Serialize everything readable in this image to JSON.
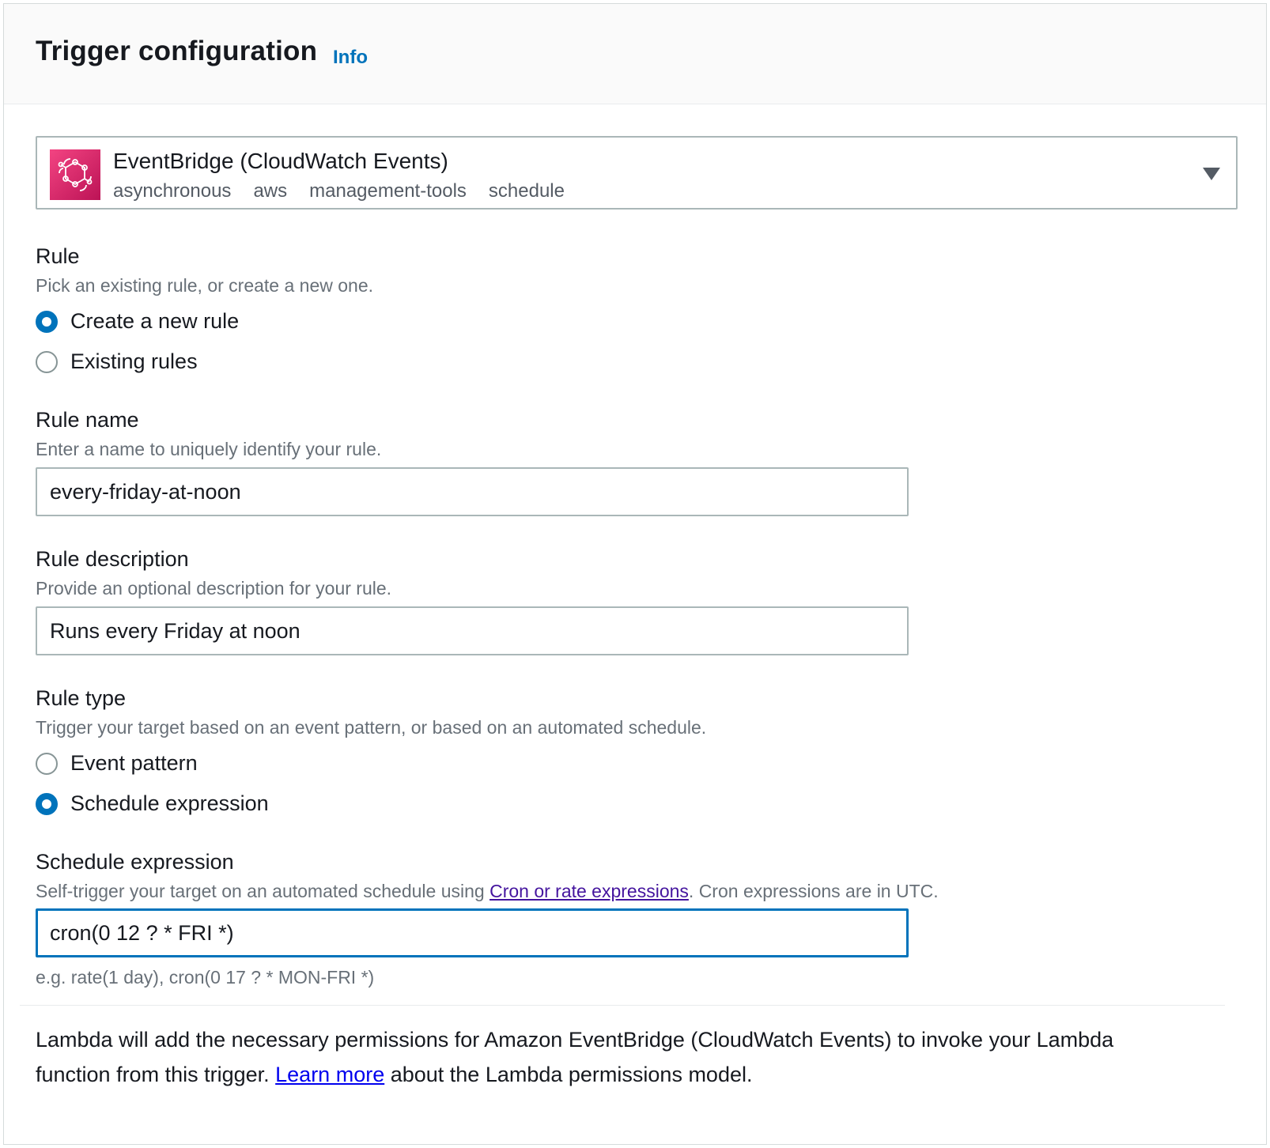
{
  "header": {
    "title": "Trigger configuration",
    "info_label": "Info"
  },
  "source": {
    "name": "EventBridge (CloudWatch Events)",
    "tags": [
      "asynchronous",
      "aws",
      "management-tools",
      "schedule"
    ],
    "icon": "eventbridge-icon",
    "icon_color": "#e7157b"
  },
  "rule": {
    "label": "Rule",
    "description": "Pick an existing rule, or create a new one.",
    "options": [
      {
        "label": "Create a new rule",
        "checked": true
      },
      {
        "label": "Existing rules",
        "checked": false
      }
    ]
  },
  "rule_name": {
    "label": "Rule name",
    "description": "Enter a name to uniquely identify your rule.",
    "value": "every-friday-at-noon"
  },
  "rule_description": {
    "label": "Rule description",
    "description": "Provide an optional description for your rule.",
    "value": "Runs every Friday at noon"
  },
  "rule_type": {
    "label": "Rule type",
    "description": "Trigger your target based on an event pattern, or based on an automated schedule.",
    "options": [
      {
        "label": "Event pattern",
        "checked": false
      },
      {
        "label": "Schedule expression",
        "checked": true
      }
    ]
  },
  "schedule_expression": {
    "label": "Schedule expression",
    "description_prefix": "Self-trigger your target on an automated schedule using ",
    "description_link": "Cron or rate expressions",
    "description_suffix": ". Cron expressions are in UTC.",
    "value": "cron(0 12 ? * FRI *)",
    "hint": "e.g. rate(1 day), cron(0 17 ? * MON-FRI *)"
  },
  "footer": {
    "text_prefix": "Lambda will add the necessary permissions for Amazon EventBridge (CloudWatch Events) to invoke your Lambda function from this trigger. ",
    "link": "Learn more",
    "text_suffix": " about the Lambda permissions model."
  },
  "colors": {
    "accent": "#0073bb",
    "visited_link": "#44149e",
    "link": "#0000ee"
  }
}
